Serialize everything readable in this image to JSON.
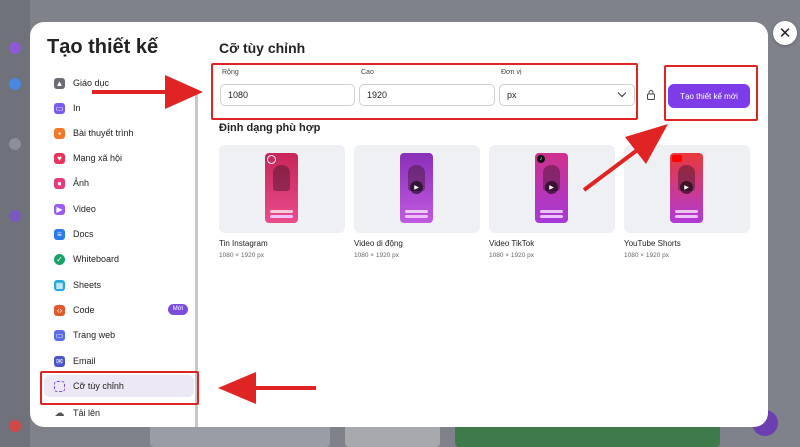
{
  "modal": {
    "title": "Tạo thiết kế",
    "close_glyph": "✕"
  },
  "sidebar": {
    "items": [
      {
        "label": "Giáo dục",
        "icon": "graduation-cap-icon",
        "color": "#6b6b73"
      },
      {
        "label": "In",
        "icon": "printer-icon",
        "color": "#7a5af0"
      },
      {
        "label": "Bài thuyết trình",
        "icon": "presentation-icon",
        "color": "#f07a2a"
      },
      {
        "label": "Mạng xã hội",
        "icon": "heart-icon",
        "color": "#e8345a"
      },
      {
        "label": "Ảnh",
        "icon": "camera-icon",
        "color": "#e53a7d"
      },
      {
        "label": "Video",
        "icon": "video-icon",
        "color": "#9b5cf0"
      },
      {
        "label": "Docs",
        "icon": "docs-icon",
        "color": "#2d7be8"
      },
      {
        "label": "Whiteboard",
        "icon": "whiteboard-icon",
        "color": "#19a36b"
      },
      {
        "label": "Sheets",
        "icon": "sheets-icon",
        "color": "#2aa8d8"
      },
      {
        "label": "Code",
        "icon": "code-icon",
        "color": "#e05a2a",
        "badge": "Mới"
      },
      {
        "label": "Trang web",
        "icon": "website-icon",
        "color": "#5a6ee8"
      },
      {
        "label": "Email",
        "icon": "email-icon",
        "color": "#4a55c8"
      },
      {
        "label": "Cỡ tùy chỉnh",
        "icon": "custom-size-icon",
        "color": "#7c4ddc"
      },
      {
        "label": "Tải lên",
        "icon": "cloud-upload-icon",
        "color": "#555555"
      }
    ]
  },
  "custom": {
    "title": "Cỡ tùy chỉnh",
    "width_label": "Rộng",
    "width_value": "1080",
    "height_label": "Cao",
    "height_value": "1920",
    "unit_label": "Đơn vị",
    "unit_value": "px",
    "create_label": "Tạo thiết kế mới"
  },
  "formats": {
    "title": "Định dạng phù hợp",
    "cards": [
      {
        "name": "Tin Instagram",
        "size": "1080 × 1920 px",
        "icon": "instagram-icon",
        "colors": [
          "#c8265a",
          "#e84c8a"
        ]
      },
      {
        "name": "Video di động",
        "size": "1080 × 1920 px",
        "icon": "play-icon",
        "colors": [
          "#8b2fb8",
          "#c05ae0"
        ]
      },
      {
        "name": "Video TikTok",
        "size": "1080 × 1920 px",
        "icon": "tiktok-icon",
        "colors": [
          "#d0308c",
          "#a43ad8"
        ]
      },
      {
        "name": "YouTube Shorts",
        "size": "1080 × 1920 px",
        "icon": "youtube-icon",
        "colors": [
          "#e83a3a",
          "#b03ad8"
        ]
      }
    ]
  },
  "annotation_color": "#e02424",
  "accent": "#7d3ce8"
}
